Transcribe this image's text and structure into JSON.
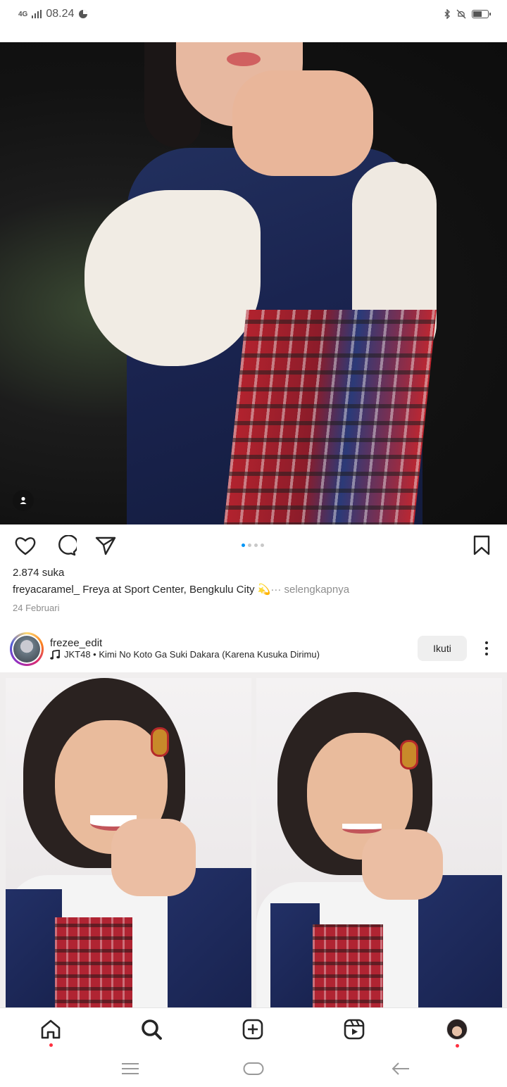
{
  "status_bar": {
    "network": "4G",
    "time": "08.24"
  },
  "post1": {
    "likes": "2.874 suka",
    "username": "freyacaramel_",
    "caption": " Freya at Sport Center, Bengkulu City 💫",
    "more": "··· selengkapnya",
    "date": "24 Februari",
    "carousel_pages": 4,
    "carousel_active": 1
  },
  "post2": {
    "username": "frezee_edit",
    "music": "JKT48 • Kimi No Koto Ga Suki Dakara (Karena Kusuka Dirimu)",
    "follow_label": "Ikuti"
  },
  "icons": {
    "like": "heart-icon",
    "comment": "comment-icon",
    "share": "send-icon",
    "save": "bookmark-icon",
    "tag": "person-tag-icon",
    "music": "music-note-icon",
    "more": "kebab-icon",
    "nav": [
      "home-icon",
      "search-icon",
      "create-icon",
      "reels-icon",
      "profile-avatar"
    ],
    "system": [
      "menu-icon",
      "home-pill-icon",
      "back-icon"
    ]
  },
  "colors": {
    "accent": "#0095f6",
    "notification": "#ff3040",
    "follow_button_bg": "#efefef"
  }
}
